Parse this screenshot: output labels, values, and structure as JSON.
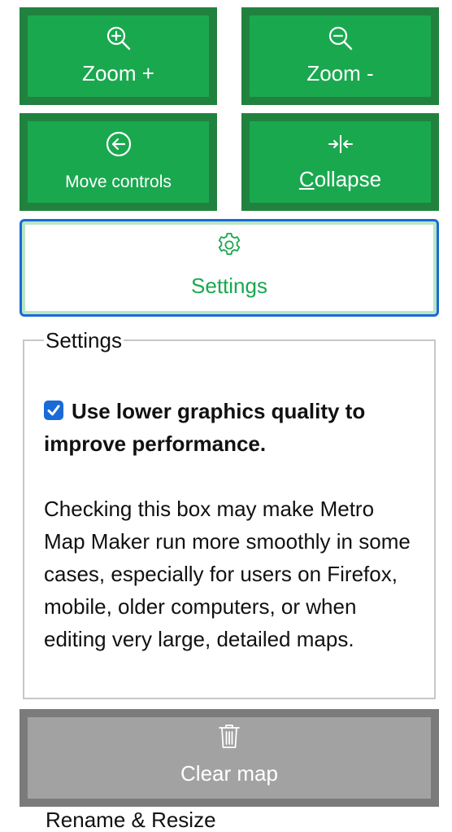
{
  "controls": {
    "zoom_in": {
      "label": "Zoom +",
      "icon": "zoom-in-icon"
    },
    "zoom_out": {
      "label": "Zoom -",
      "icon": "zoom-out-icon"
    },
    "move_controls": {
      "label": "Move controls",
      "icon": "arrow-left-circle-icon"
    },
    "collapse": {
      "label_accesskey": "C",
      "label_rest": "ollapse",
      "icon": "collapse-icon"
    }
  },
  "settings_button": {
    "label": "Settings",
    "icon": "gear-icon"
  },
  "settings_panel": {
    "legend": "Settings",
    "option_label": "Use lower graphics quality to improve performance.",
    "option_checked": true,
    "description": "Checking this box may make Metro Map Maker run more smoothly in some cases, especially for users on Firefox, mobile, older computers, or when editing very large, detailed maps."
  },
  "clear_map": {
    "label": "Clear map",
    "icon": "trash-icon"
  },
  "next_section_partial": "Rename & Resize",
  "colors": {
    "button_green": "#1aa84f",
    "button_green_border": "#21823f",
    "focus_blue": "#1a6ad8",
    "clear_gray": "#a2a2a2"
  }
}
